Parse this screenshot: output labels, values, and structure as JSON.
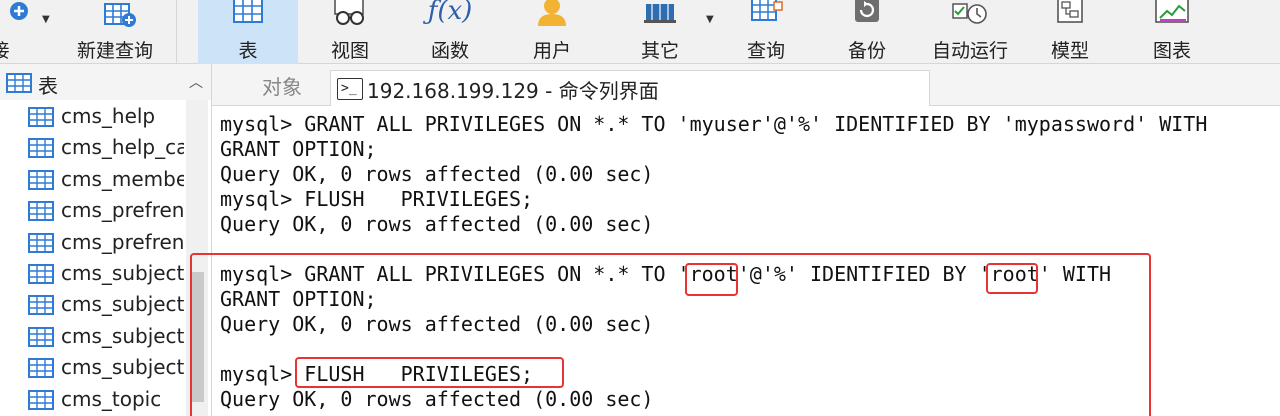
{
  "toolbar": {
    "items": [
      {
        "label": "接",
        "icon": "connect-icon"
      },
      {
        "label": "新建查询",
        "icon": "new-query-icon"
      },
      {
        "label": "表",
        "icon": "table-icon",
        "active": true
      },
      {
        "label": "视图",
        "icon": "view-icon"
      },
      {
        "label": "函数",
        "icon": "function-icon"
      },
      {
        "label": "用户",
        "icon": "user-icon"
      },
      {
        "label": "其它",
        "icon": "other-icon"
      },
      {
        "label": "查询",
        "icon": "query-icon"
      },
      {
        "label": "备份",
        "icon": "backup-icon"
      },
      {
        "label": "自动运行",
        "icon": "auto-run-icon"
      },
      {
        "label": "模型",
        "icon": "model-icon"
      },
      {
        "label": "图表",
        "icon": "chart-icon"
      }
    ],
    "fx_glyph": "ƒ(x)"
  },
  "sidebar": {
    "title": "表",
    "items": [
      "cms_help",
      "cms_help_cat",
      "cms_member",
      "cms_prefrenc",
      "cms_prefrenc",
      "cms_subject",
      "cms_subject_",
      "cms_subject_",
      "cms_subject_",
      "cms_topic"
    ]
  },
  "tabs": {
    "objects": "对象",
    "console": "192.168.199.129 - 命令列界面",
    "console_icon_glyph": ">_"
  },
  "console": {
    "lines": [
      "mysql> GRANT ALL PRIVILEGES ON *.* TO 'myuser'@'%' IDENTIFIED BY 'mypassword' WITH",
      "GRANT OPTION;",
      "Query OK, 0 rows affected (0.00 sec)",
      "mysql> FLUSH   PRIVILEGES;",
      "Query OK, 0 rows affected (0.00 sec)",
      "",
      "mysql> GRANT ALL PRIVILEGES ON *.* TO 'root'@'%' IDENTIFIED BY 'root' WITH",
      "GRANT OPTION;",
      "Query OK, 0 rows affected (0.00 sec)",
      "",
      "mysql> FLUSH   PRIVILEGES;",
      "Query OK, 0 rows affected (0.00 sec)"
    ]
  },
  "colors": {
    "accent_active_tab": "#cde3f7",
    "highlight_red": "#e53434",
    "table_icon_blue": "#2e7bd6"
  }
}
